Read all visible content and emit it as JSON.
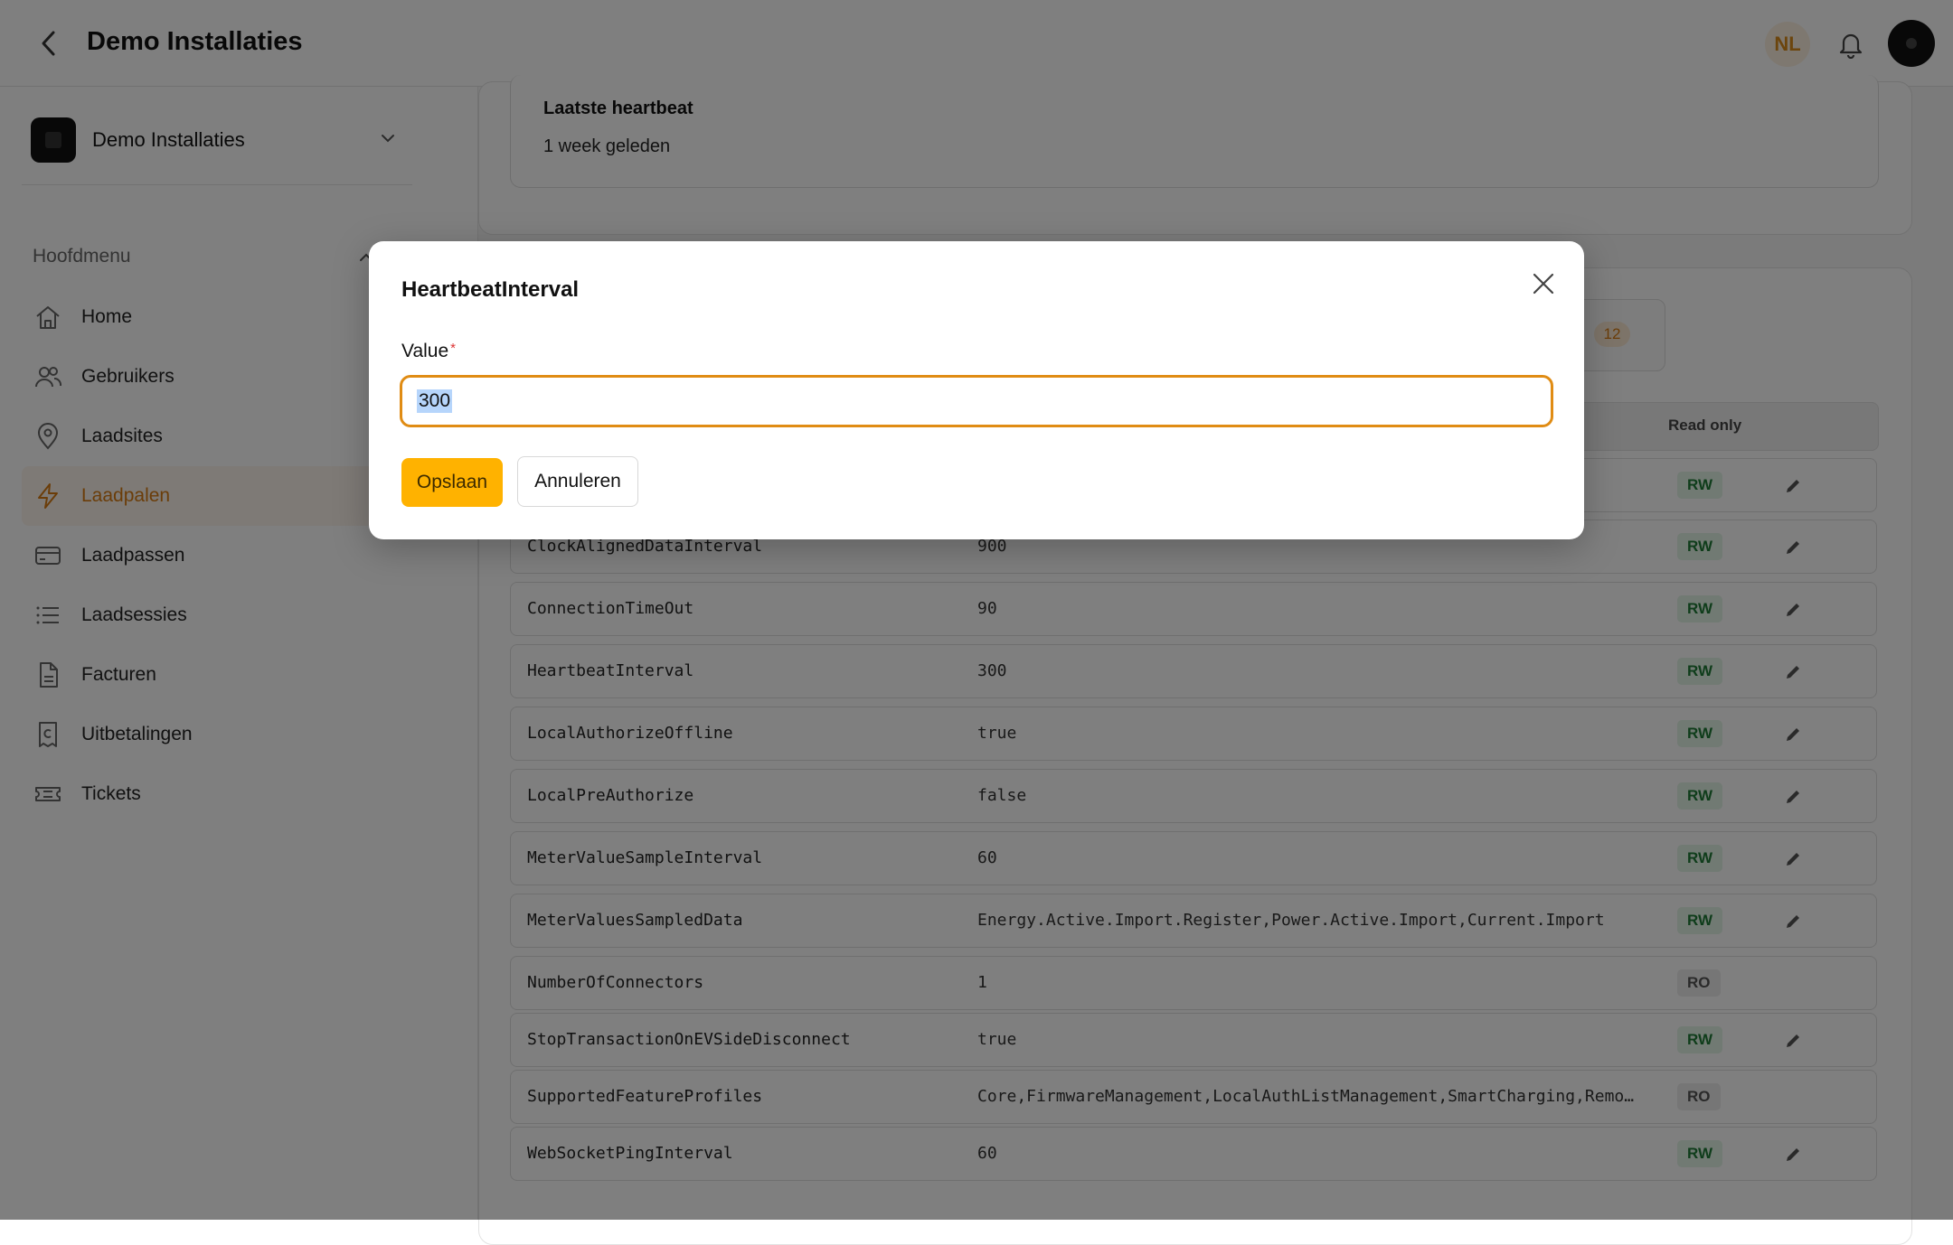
{
  "header": {
    "title": "Demo Installaties",
    "language": "NL",
    "icons": [
      "back-arrow-icon",
      "bell-icon",
      "avatar"
    ]
  },
  "sidebar": {
    "org_name": "Demo Installaties",
    "section_label": "Hoofdmenu",
    "items": [
      {
        "label": "Home",
        "icon": "home-icon"
      },
      {
        "label": "Gebruikers",
        "icon": "users-icon"
      },
      {
        "label": "Laadsites",
        "icon": "location-pin-icon"
      },
      {
        "label": "Laadpalen",
        "icon": "lightning-icon",
        "active": true
      },
      {
        "label": "Laadpassen",
        "icon": "card-icon"
      },
      {
        "label": "Laadsessies",
        "icon": "list-icon"
      },
      {
        "label": "Facturen",
        "icon": "document-icon"
      },
      {
        "label": "Uitbetalingen",
        "icon": "receipt-icon"
      },
      {
        "label": "Tickets",
        "icon": "ticket-icon"
      }
    ]
  },
  "main": {
    "heartbeat_label": "Laatste heartbeat",
    "heartbeat_value": "1 week geleden",
    "count_badge": "12",
    "column_read_only": "Read only",
    "rows": [
      {
        "key": "ClockAlignedDataInterval",
        "value": "900",
        "access": "RW"
      },
      {
        "key": "ConnectionTimeOut",
        "value": "90",
        "access": "RW"
      },
      {
        "key": "HeartbeatInterval",
        "value": "300",
        "access": "RW"
      },
      {
        "key": "LocalAuthorizeOffline",
        "value": "true",
        "access": "RW"
      },
      {
        "key": "LocalPreAuthorize",
        "value": "false",
        "access": "RW"
      },
      {
        "key": "MeterValueSampleInterval",
        "value": "60",
        "access": "RW"
      },
      {
        "key": "MeterValuesSampledData",
        "value": "Energy.Active.Import.Register,Power.Active.Import,Current.Import",
        "access": "RW"
      },
      {
        "key": "NumberOfConnectors",
        "value": "1",
        "access": "RO"
      },
      {
        "key": "StopTransactionOnEVSideDisconnect",
        "value": "true",
        "access": "RW"
      },
      {
        "key": "SupportedFeatureProfiles",
        "value": "Core,FirmwareManagement,LocalAuthListManagement,SmartCharging,Remo…",
        "access": "RO"
      },
      {
        "key": "WebSocketPingInterval",
        "value": "60",
        "access": "RW"
      }
    ],
    "first_row_badge": "RW"
  },
  "modal": {
    "title": "HeartbeatInterval",
    "field_label": "Value",
    "required_mark": "*",
    "field_value": "300",
    "save_label": "Opslaan",
    "cancel_label": "Annuleren"
  },
  "colors": {
    "accent": "#ffb200",
    "active_nav": "#d67b12",
    "input_focus": "#e08c14",
    "rw_badge": "#1f7a36"
  }
}
